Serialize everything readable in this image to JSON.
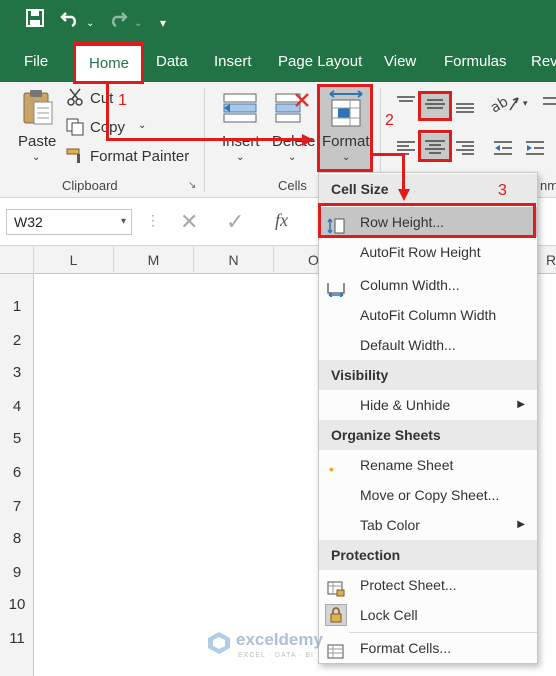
{
  "quick_access": {
    "save_icon": "save-icon",
    "undo_icon": "undo-icon",
    "redo_icon": "redo-icon",
    "customize_icon": "customize-icon"
  },
  "tabs": [
    {
      "label": "File"
    },
    {
      "label": "Home"
    },
    {
      "label": "Data"
    },
    {
      "label": "Insert"
    },
    {
      "label": "Page Layout"
    },
    {
      "label": "View"
    },
    {
      "label": "Formulas"
    },
    {
      "label": "Rev"
    }
  ],
  "ribbon": {
    "clipboard": {
      "paste": "Paste",
      "cut": "Cut",
      "copy": "Copy",
      "format_painter": "Format Painter",
      "label": "Clipboard"
    },
    "cells": {
      "insert": "Insert",
      "delete": "Delete",
      "format": "Format",
      "label": "Cells"
    },
    "alignment_label": "nm"
  },
  "formula_bar": {
    "name_box": "W32",
    "fx": "fx"
  },
  "columns": [
    "L",
    "M",
    "N",
    "O",
    "R"
  ],
  "rows": [
    "1",
    "2",
    "3",
    "4",
    "5",
    "6",
    "7",
    "8",
    "9",
    "10",
    "11"
  ],
  "format_menu": {
    "sections": [
      {
        "title": "Cell Size",
        "items": [
          "Row Height...",
          "AutoFit Row Height",
          "Column Width...",
          "AutoFit Column Width",
          "Default Width..."
        ]
      },
      {
        "title": "Visibility",
        "items": [
          "Hide & Unhide"
        ]
      },
      {
        "title": "Organize Sheets",
        "items": [
          "Rename Sheet",
          "Move or Copy Sheet...",
          "Tab Color"
        ]
      },
      {
        "title": "Protection",
        "items": [
          "Protect Sheet...",
          "Lock Cell"
        ]
      }
    ],
    "format_cells": "Format Cells..."
  },
  "annotations": {
    "step1": "1",
    "step2": "2",
    "step3": "3"
  },
  "watermark": {
    "brand": "exceldemy",
    "tagline": "EXCEL · DATA · BI"
  },
  "colors": {
    "excel_green": "#217346",
    "annotation_red": "#e01b1b",
    "highlight_blue": "#cfe1f3"
  }
}
